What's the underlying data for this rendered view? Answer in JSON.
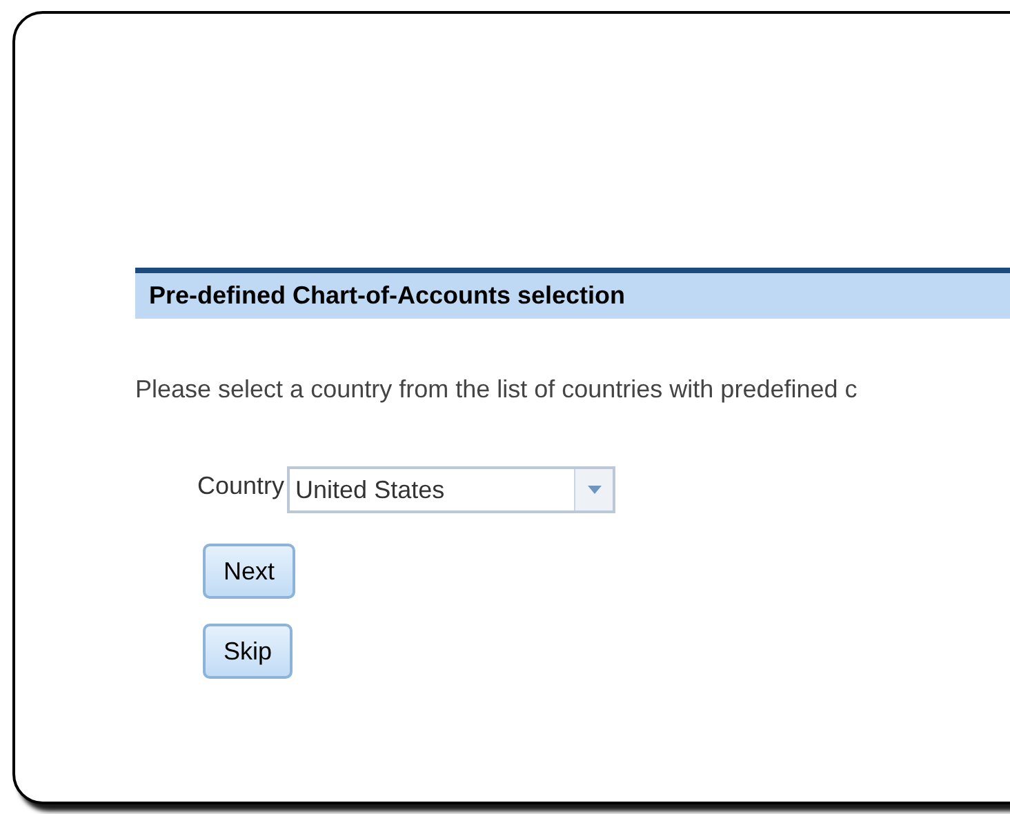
{
  "section": {
    "title": "Pre-defined Chart-of-Accounts selection"
  },
  "instructions": "Please select a country from the list of countries with predefined c",
  "country_field": {
    "label": "Country",
    "value": "United States"
  },
  "buttons": [
    "Next",
    "Skip"
  ]
}
